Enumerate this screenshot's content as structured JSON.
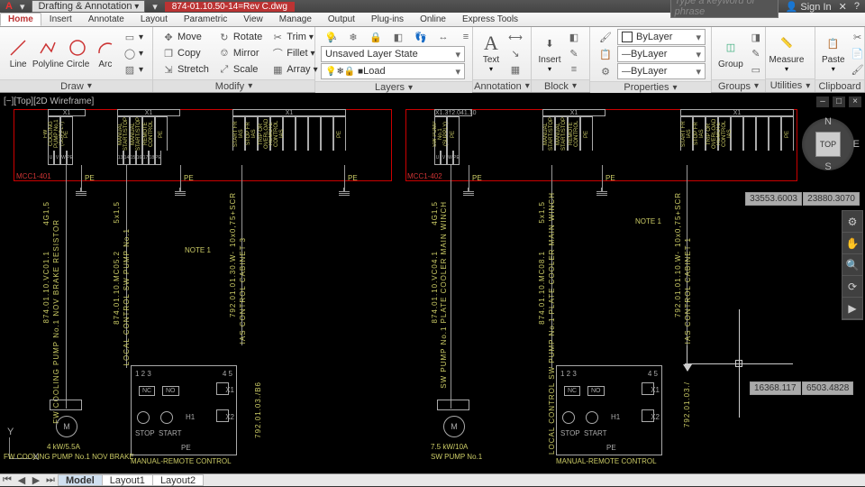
{
  "qat": {
    "workspace": "Drafting & Annotation",
    "file": "874-01.10.50-14=Rev C.dwg",
    "keyword_ph": "Type a keyword or phrase",
    "signin": "Sign In"
  },
  "tabs": [
    "Home",
    "Insert",
    "Annotate",
    "Layout",
    "Parametric",
    "View",
    "Manage",
    "Output",
    "Plug-ins",
    "Online",
    "Express Tools"
  ],
  "active_tab": "Home",
  "ribbon": {
    "draw": {
      "title": "Draw",
      "line": "Line",
      "polyline": "Polyline",
      "circle": "Circle",
      "arc": "Arc"
    },
    "modify": {
      "title": "Modify",
      "move": "Move",
      "copy": "Copy",
      "stretch": "Stretch",
      "rotate": "Rotate",
      "mirror": "Mirror",
      "scale": "Scale",
      "trim": "Trim",
      "fillet": "Fillet",
      "array": "Array"
    },
    "layers": {
      "title": "Layers",
      "state": "Unsaved Layer State",
      "load": "Load"
    },
    "annotation": {
      "title": "Annotation",
      "text": "Text"
    },
    "block": {
      "title": "Block",
      "insert": "Insert"
    },
    "properties": {
      "title": "Properties",
      "color": "ByLayer",
      "ltype": "ByLayer",
      "lw": "ByLayer"
    },
    "groups": {
      "title": "Groups",
      "group": "Group"
    },
    "utilities": {
      "title": "Utilities",
      "measure": "Measure"
    },
    "clipboard": {
      "title": "Clipboard",
      "paste": "Paste"
    }
  },
  "viewlabel": "[−][Top][2D Wireframe]",
  "viewcube": {
    "top": "TOP",
    "n": "N",
    "s": "S",
    "e": "E"
  },
  "coords": {
    "tr1": "33553.6003",
    "tr2": "23880.3070",
    "cur1": "16368.117",
    "cur2": "6503.4828"
  },
  "drawing": {
    "redlabel1": "MCC1-401",
    "redlabel2": "MCC1-402",
    "x1": "X1",
    "termlabel": "X1.3†2.041.10",
    "cells": [
      "FW COOLING PUMP No.1 (SUPPLY)",
      "PE",
      "MANUAL START/STOP",
      "MANUAL START/STOP",
      "REMOTE CONTROL",
      "PE",
      "START FR IAS",
      "STOP FR IAS",
      "TRIP OR OVERLOAD",
      "REMOTE CONTROL IAS",
      "PE"
    ],
    "vlabels": {
      "b1": "FW COOLING PUMP No.1 NOV BRAKE RESISTOR",
      "b1r": "874.01.10.VC01.1",
      "b1s": "4G1,5",
      "b2": "LOCAL CONTROL SW PUMP No.1",
      "b2r": "874.01.10.MC05.2",
      "b2s": "5x1,5",
      "b3": "IAS CONTROL CABINET 3",
      "b3r": "792.01.01.30.W-",
      "b3s": "10x0,75+SCR",
      "b4": "SW PUMP No.1 PLATE COOLER MAIN WINCH",
      "b4r": "874.01.10.VC04.1",
      "b4s": "4G1,5",
      "b5": "LOCAL CONTROL SW PUMP No.1 PLATE COOLER MAIN WINCH",
      "b5r": "874.01.10.MC08.1",
      "b5s": "5x1,5",
      "b6": "IAS CONTROL CABINET 1",
      "b6r": "792.01.01.10.W-",
      "b6s": "10x0,75+SCR"
    },
    "note": "NOTE 1",
    "pe": "PE",
    "ctrl": {
      "nc": "NC",
      "no": "NO",
      "stop": "STOP",
      "start": "START",
      "h1": "H1",
      "x1": "X1",
      "x2": "X2"
    },
    "m": "M",
    "rat1": "4 kW/5.5A",
    "rat2": "7.5 kW/10A",
    "manual": "MANUAL-REMOTE CONTROL",
    "foot1": "FW COOLING PUMP No.1 NOV BRAKE",
    "foot2": "SW PUMP No.1",
    "cab": "792.01.03./B6"
  },
  "sheets": {
    "model": "Model",
    "l1": "Layout1",
    "l2": "Layout2"
  }
}
